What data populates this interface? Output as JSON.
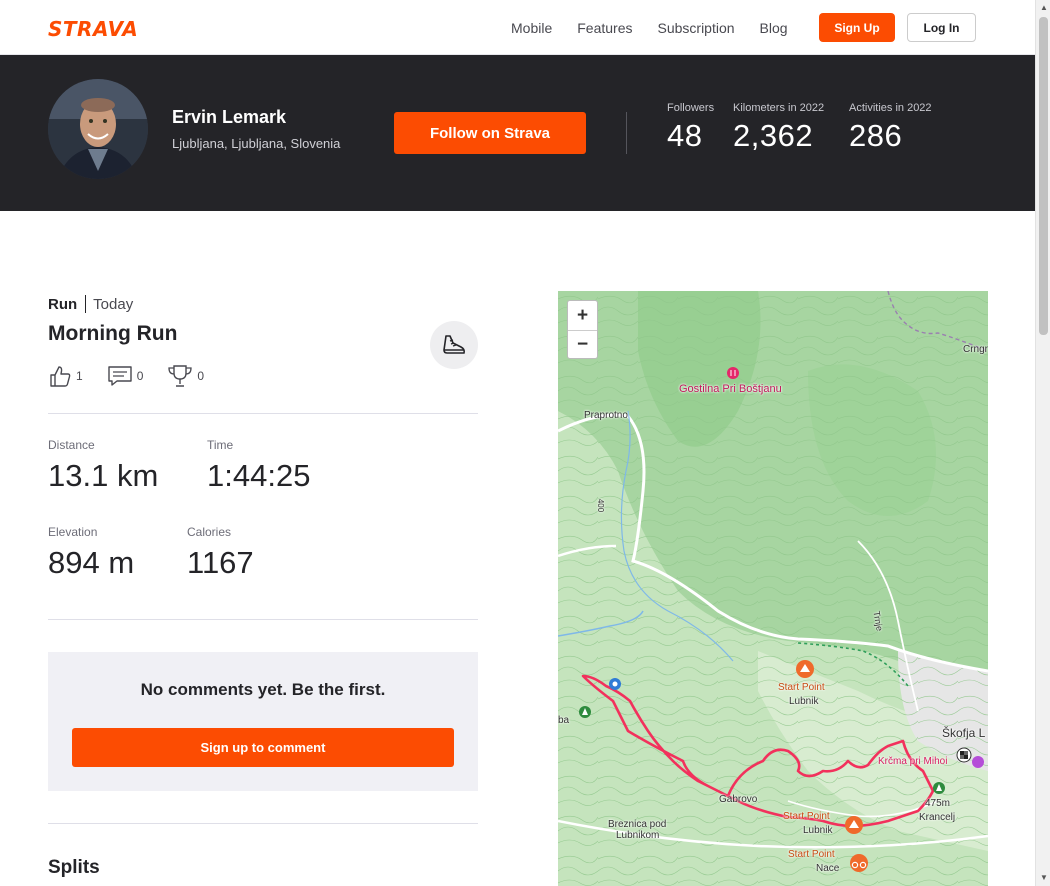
{
  "nav": {
    "logo": "STRAVA",
    "links": [
      "Mobile",
      "Features",
      "Subscription",
      "Blog"
    ],
    "signup": "Sign Up",
    "login": "Log In"
  },
  "athlete": {
    "name": "Ervin Lemark",
    "location": "Ljubljana, Ljubljana, Slovenia",
    "follow": "Follow on Strava",
    "stats": [
      {
        "label": "Followers",
        "value": "48"
      },
      {
        "label": "Kilometers in 2022",
        "value": "2,362"
      },
      {
        "label": "Activities in 2022",
        "value": "286"
      }
    ]
  },
  "activity": {
    "type": "Run",
    "when": "Today",
    "title": "Morning Run",
    "kudos": "1",
    "comments": "0",
    "achievements": "0",
    "metrics": [
      {
        "label": "Distance",
        "value": "13.1 km"
      },
      {
        "label": "Time",
        "value": "1:44:25"
      },
      {
        "label": "Elevation",
        "value": "894 m"
      },
      {
        "label": "Calories",
        "value": "1167"
      }
    ]
  },
  "comments": {
    "empty": "No comments yet. Be the first.",
    "signup": "Sign up to comment"
  },
  "splits": {
    "title": "Splits"
  },
  "map": {
    "zoom_in": "+",
    "zoom_out": "−",
    "labels": {
      "gostilna": "Gostilna Pri Boštjanu",
      "praprotno": "Praprotno",
      "crngrob": "Crngr",
      "start1": "Start Point",
      "lubnik1": "Lubnik",
      "start2": "Start Point",
      "lubnik2": "Lubnik",
      "start3": "Start Point",
      "nace": "Nace",
      "gabrovo": "Gabrovo",
      "breznica1": "Breznica pod",
      "breznica2": "Lubnikom",
      "krcma": "Krčma pri Mihoi",
      "elev": "475m",
      "krancelj": "Krancelj",
      "skofja": "Škofja L",
      "trnje": "Trnje",
      "road400": "400",
      "ba": "ba"
    },
    "colors": {
      "route": "#f2315c",
      "water": "#7fb8e8",
      "road": "#ffffff"
    }
  },
  "colors": {
    "brand": "#fc4c02",
    "header_bg": "#242428"
  }
}
